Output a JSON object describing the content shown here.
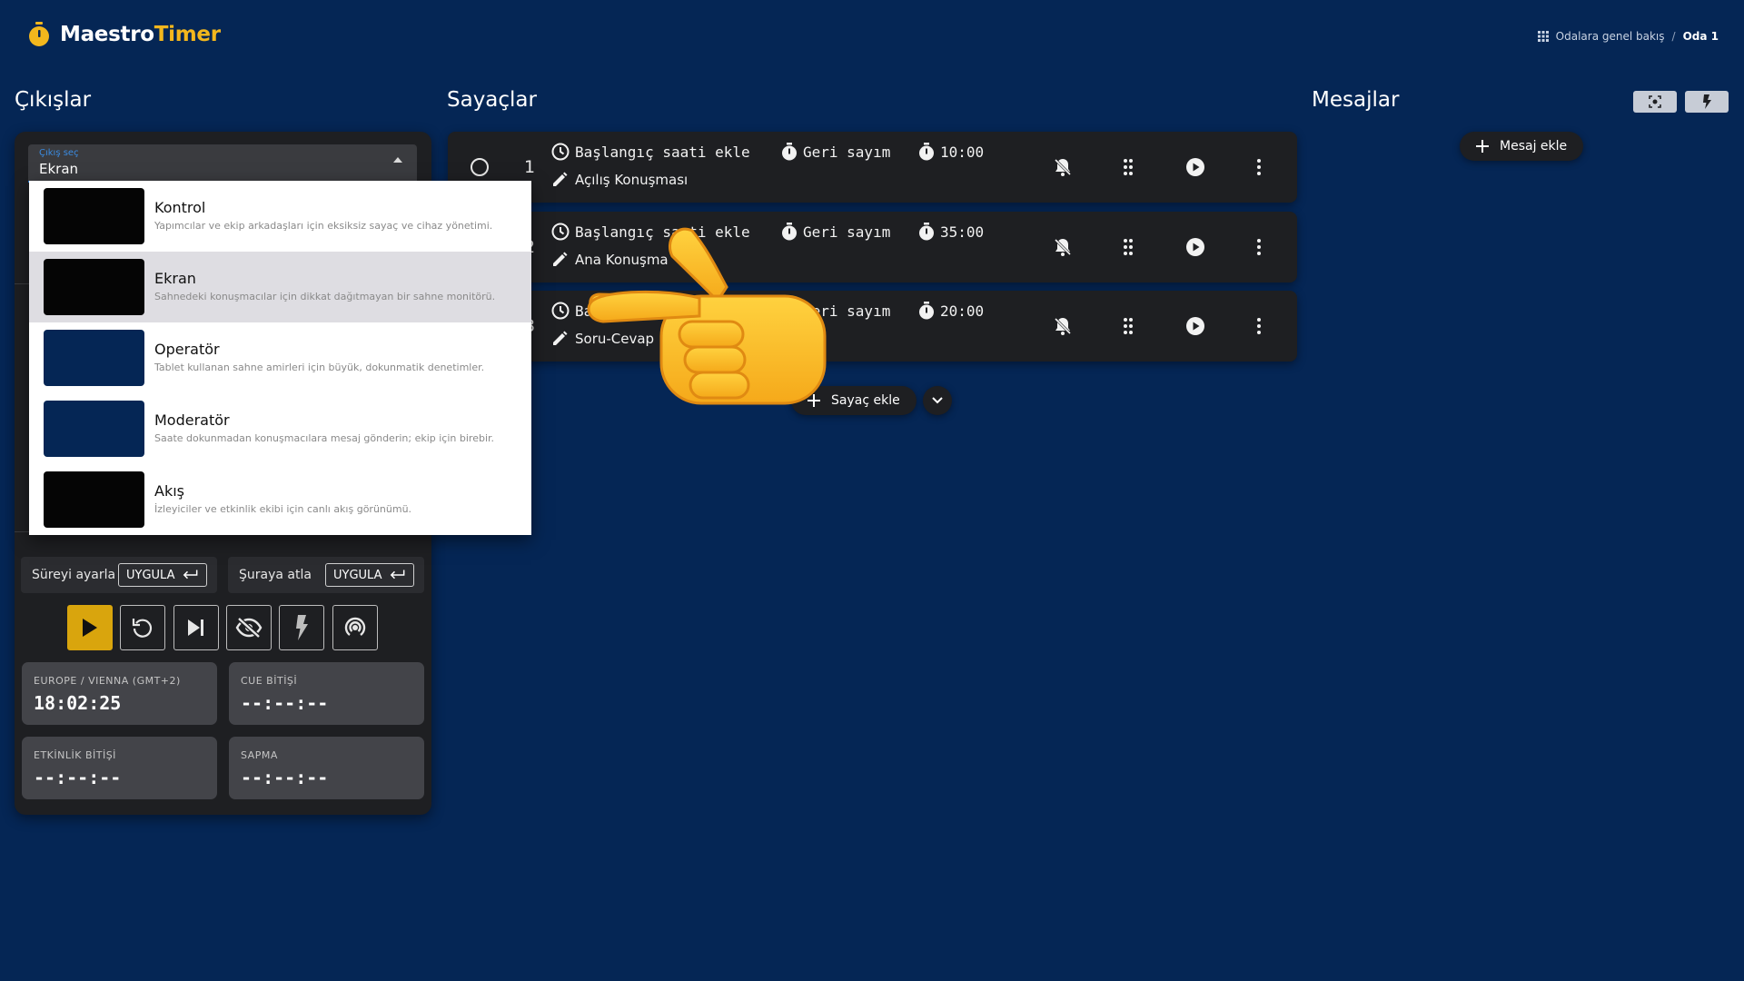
{
  "app": {
    "name_part1": "Maestro",
    "name_part2": "Timer",
    "accent_color": "#f3b71d",
    "background_color": "#052655"
  },
  "breadcrumb": {
    "overview": "Odalara genel bakış",
    "separator": "/",
    "current": "Oda 1"
  },
  "outputs": {
    "title": "Çıkışlar",
    "select": {
      "label": "Çıkış seç",
      "value": "Ekran"
    },
    "options": [
      {
        "title": "Kontrol",
        "description": "Yapımcılar ve ekip arkadaşları için eksiksiz sayaç ve cihaz yönetimi.",
        "thumb_color": "#050505"
      },
      {
        "title": "Ekran",
        "description": "Sahnedeki konuşmacılar için dikkat dağıtmayan bir sahne monitörü.",
        "thumb_color": "#050505",
        "selected": true
      },
      {
        "title": "Operatör",
        "description": "Tablet kullanan sahne amirleri için büyük, dokunmatik denetimler.",
        "thumb_color": "#052655"
      },
      {
        "title": "Moderatör",
        "description": "Saate dokunmadan konuşmacılara mesaj gönderin; ekip için birebir.",
        "thumb_color": "#052655"
      },
      {
        "title": "Akış",
        "description": "İzleyiciler ve etkinlik ekibi için canlı akış görünümü.",
        "thumb_color": "#050505"
      }
    ],
    "adjust_time_label": "Süreyi ayarla",
    "jump_to_label": "Şuraya atla",
    "apply_label": "UYGULA",
    "controls": {
      "play": "play-icon",
      "reset": "reset-icon",
      "next": "skip-next-icon",
      "blackout": "eye-off-icon",
      "flash": "flash-icon",
      "broadcast": "broadcast-icon"
    },
    "clock": {
      "label": "EUROPE / VIENNA (GMT+2)",
      "value": "18:02:25"
    },
    "cue_end": {
      "label": "CUE BİTİŞİ",
      "value": "--:--:--"
    },
    "event_end": {
      "label": "ETKİNLİK BİTİŞİ",
      "value": "--:--:--"
    },
    "deviation": {
      "label": "SAPMA",
      "value": "--:--:--"
    }
  },
  "timers": {
    "title": "Sayaçlar",
    "items": [
      {
        "number": "1",
        "start_label": "Başlangıç saati ekle",
        "mode": "Geri sayım",
        "duration": "10:00",
        "name": "Açılış Konuşması"
      },
      {
        "number": "2",
        "start_label": "Başlangıç saati ekle",
        "mode": "Geri sayım",
        "duration": "35:00",
        "name": "Ana Konuşma"
      },
      {
        "number": "3",
        "start_label": "Başlangıç saati ekle",
        "mode": "Geri sayım",
        "duration": "20:00",
        "name": "Soru-Cevap"
      }
    ],
    "add_label": "Sayaç ekle"
  },
  "messages": {
    "title": "Mesajlar",
    "add_label": "Mesaj ekle"
  }
}
